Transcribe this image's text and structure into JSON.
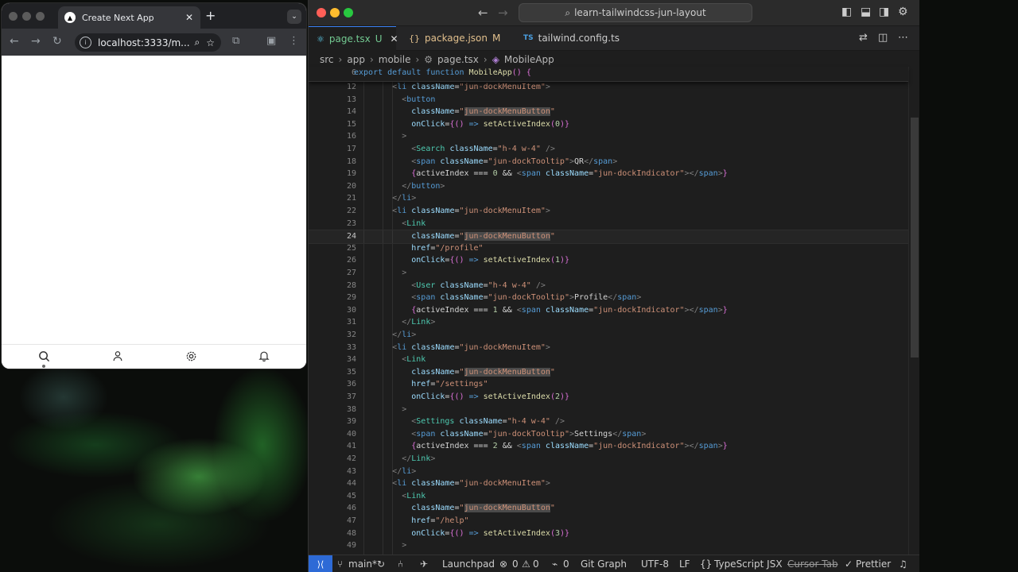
{
  "browser": {
    "tab_title": "Create Next App",
    "new_tab": "+",
    "url": "localhost:3333/m...",
    "dock": [
      "search-icon",
      "user-icon",
      "settings-icon",
      "bell-icon"
    ]
  },
  "vscode": {
    "command_center": "learn-tailwindcss-jun-layout",
    "tabs": [
      {
        "label": "page.tsx",
        "badge": "U",
        "icon": "react-icon"
      },
      {
        "label": "package.json",
        "badge": "M",
        "icon": "{}"
      },
      {
        "label": "tailwind.config.ts",
        "badge": "",
        "icon": "TS"
      }
    ],
    "breadcrumb": [
      "src",
      "app",
      "mobile",
      "page.tsx",
      "MobileApp"
    ],
    "sticky": {
      "num": "6",
      "text": "export default function MobileApp() {"
    },
    "lines": [
      {
        "num": "12",
        "text": "        <li className=\"jun-dockMenuItem\">"
      },
      {
        "num": "13",
        "text": "          <button"
      },
      {
        "num": "14",
        "text": "            className=\"jun-dockMenuButton\""
      },
      {
        "num": "15",
        "text": "            onClick={() => setActiveIndex(0)}"
      },
      {
        "num": "16",
        "text": "          >"
      },
      {
        "num": "17",
        "text": "            <Search className=\"h-4 w-4\" />"
      },
      {
        "num": "18",
        "text": "            <span className=\"jun-dockTooltip\">QR</span>"
      },
      {
        "num": "19",
        "text": "            {activeIndex === 0 && <span className=\"jun-dockIndicator\"></span>}"
      },
      {
        "num": "20",
        "text": "          </button>"
      },
      {
        "num": "21",
        "text": "        </li>"
      },
      {
        "num": "22",
        "text": "        <li className=\"jun-dockMenuItem\">"
      },
      {
        "num": "23",
        "text": "          <Link"
      },
      {
        "num": "24",
        "text": "            className=\"jun-dockMenuButton\""
      },
      {
        "num": "25",
        "text": "            href=\"/profile\""
      },
      {
        "num": "26",
        "text": "            onClick={() => setActiveIndex(1)}"
      },
      {
        "num": "27",
        "text": "          >"
      },
      {
        "num": "28",
        "text": "            <User className=\"h-4 w-4\" />"
      },
      {
        "num": "29",
        "text": "            <span className=\"jun-dockTooltip\">Profile</span>"
      },
      {
        "num": "30",
        "text": "            {activeIndex === 1 && <span className=\"jun-dockIndicator\"></span>}"
      },
      {
        "num": "31",
        "text": "          </Link>"
      },
      {
        "num": "32",
        "text": "        </li>"
      },
      {
        "num": "33",
        "text": "        <li className=\"jun-dockMenuItem\">"
      },
      {
        "num": "34",
        "text": "          <Link"
      },
      {
        "num": "35",
        "text": "            className=\"jun-dockMenuButton\""
      },
      {
        "num": "36",
        "text": "            href=\"/settings\""
      },
      {
        "num": "37",
        "text": "            onClick={() => setActiveIndex(2)}"
      },
      {
        "num": "38",
        "text": "          >"
      },
      {
        "num": "39",
        "text": "            <Settings className=\"h-4 w-4\" />"
      },
      {
        "num": "40",
        "text": "            <span className=\"jun-dockTooltip\">Settings</span>"
      },
      {
        "num": "41",
        "text": "            {activeIndex === 2 && <span className=\"jun-dockIndicator\"></span>}"
      },
      {
        "num": "42",
        "text": "          </Link>"
      },
      {
        "num": "43",
        "text": "        </li>"
      },
      {
        "num": "44",
        "text": "        <li className=\"jun-dockMenuItem\">"
      },
      {
        "num": "45",
        "text": "          <Link"
      },
      {
        "num": "46",
        "text": "            className=\"jun-dockMenuButton\""
      },
      {
        "num": "47",
        "text": "            href=\"/help\""
      },
      {
        "num": "48",
        "text": "            onClick={() => setActiveIndex(3)}"
      },
      {
        "num": "49",
        "text": "          >"
      }
    ],
    "status": {
      "branch": "main*",
      "launchpad": "Launchpad",
      "problems": "0",
      "warnings": "0",
      "ports": "0",
      "git_graph": "Git Graph",
      "encoding": "UTF-8",
      "eol": "LF",
      "language": "TypeScript JSX",
      "cursor_tab": "Cursor Tab",
      "prettier": "Prettier"
    }
  }
}
